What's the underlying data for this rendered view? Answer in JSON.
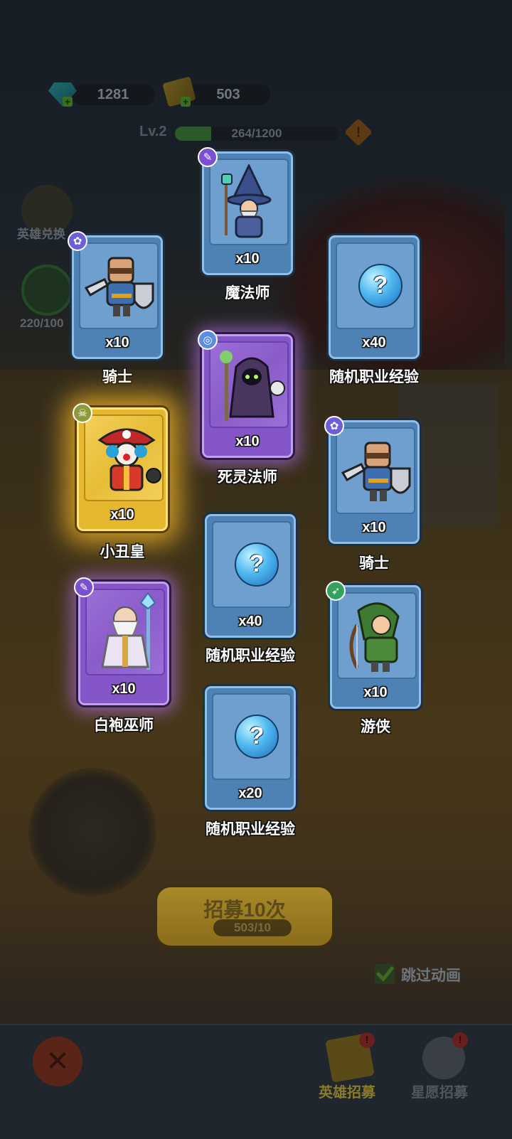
{
  "resources": {
    "gems": "1281",
    "tickets": "503"
  },
  "level": {
    "label": "Lv.2",
    "xp_text": "264/1200",
    "xp_fraction": 0.22
  },
  "side": {
    "hero_exchange": "英雄兑换",
    "progress": "220/100"
  },
  "cards": [
    {
      "count": "x10",
      "name": "魔法师",
      "rarity": "blue",
      "badge": "wand-icon",
      "art": "wizard"
    },
    {
      "count": "x10",
      "name": "骑士",
      "rarity": "blue",
      "badge": "paw-icon",
      "art": "knight"
    },
    {
      "count": "x40",
      "name": "随机职业经验",
      "rarity": "blue",
      "badge": "",
      "art": "question"
    },
    {
      "count": "x10",
      "name": "死灵法师",
      "rarity": "purple",
      "badge": "spiral-icon",
      "art": "necromancer"
    },
    {
      "count": "x10",
      "name": "小丑皇",
      "rarity": "gold",
      "badge": "skull-icon",
      "art": "clown-pirate"
    },
    {
      "count": "x10",
      "name": "骑士",
      "rarity": "blue",
      "badge": "paw-icon",
      "art": "knight"
    },
    {
      "count": "x40",
      "name": "随机职业经验",
      "rarity": "blue",
      "badge": "",
      "art": "question"
    },
    {
      "count": "x10",
      "name": "白袍巫师",
      "rarity": "purple",
      "badge": "wand-icon",
      "art": "white-wizard"
    },
    {
      "count": "x10",
      "name": "游侠",
      "rarity": "blue",
      "badge": "bow-icon",
      "art": "ranger"
    },
    {
      "count": "x20",
      "name": "随机职业经验",
      "rarity": "blue",
      "badge": "",
      "art": "question"
    }
  ],
  "question_mark": "?",
  "recruit": {
    "label": "招募10次",
    "cost": "503/10"
  },
  "skip_animation": "跳过动画",
  "bottom_nav": {
    "hero_recruit": "英雄招募",
    "star_recruit": "星愿招募"
  },
  "colors": {
    "card_blue": "#4f82b4",
    "card_purple": "#8456c8",
    "card_gold": "#e5b830",
    "active_tab": "#8a7a2a"
  }
}
